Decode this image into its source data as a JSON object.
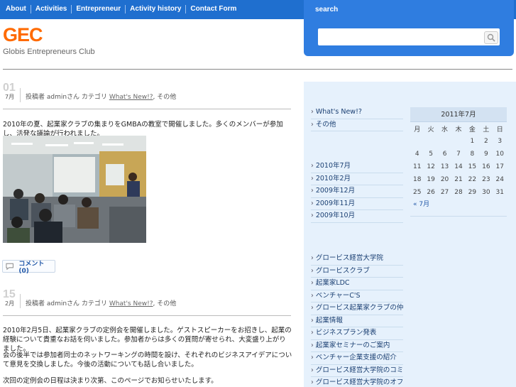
{
  "nav": {
    "items": [
      "About",
      "Activities",
      "Entrepreneur",
      "Activity history",
      "Contact Form"
    ]
  },
  "search": {
    "label": "search",
    "placeholder": ""
  },
  "site": {
    "logo": "GEC",
    "tagline": "Globis Entrepreneurs Club"
  },
  "posts": [
    {
      "day": "01",
      "month": "7月",
      "meta_prefix": "投稿者 adminさん カテゴリ",
      "category": "What's New!?",
      "meta_suffix": "その他",
      "text": "2010年の夏、起業家クラブの集まりをGMBAの教室で開催しました。多くのメンバーが参加し、活発な議論が行われました。",
      "comment_label": "コメント (0)"
    },
    {
      "day": "15",
      "month": "2月",
      "meta_prefix": "投稿者 adminさん カテゴリ",
      "category": "What's New!?",
      "meta_suffix": "その他",
      "paragraphs": [
        "2010年2月5日、起業家クラブの定例会を開催しました。ゲストスピーカーをお招きし、起業の経験について貴重なお話を伺いました。参加者からは多くの質問が寄せられ、大変盛り上がりました。",
        "会の後半では参加者同士のネットワーキングの時間を設け、それぞれのビジネスアイデアについて意見を交換しました。今後の活動についても話し合いました。",
        "次回の定例会の日程は決まり次第、このページでお知らせいたします。"
      ]
    }
  ],
  "sidebar": {
    "categories": [
      "What's New!?",
      "その他"
    ],
    "archives": [
      "2010年7月",
      "2010年2月",
      "2009年12月",
      "2009年11月",
      "2009年10月"
    ],
    "links": [
      "グロービス経営大学院",
      "グロービスクラブ",
      "起業家LDC",
      "ベンチャーC'S",
      "グロービス起業家クラブの仲間たち",
      "起業情報",
      "ビジネスプラン発表",
      "起業家セミナーのご案内",
      "ベンチャー企業支援の紹介",
      "グロービス経営大学院のコミュニティ",
      "グロービス経営大学院のオフィシャルサイト"
    ]
  },
  "calendar": {
    "caption": "2011年7月",
    "weekdays": [
      "月",
      "火",
      "水",
      "木",
      "金",
      "土",
      "日"
    ],
    "weeks": [
      [
        "",
        "",
        "",
        "",
        "1",
        "2",
        "3"
      ],
      [
        "4",
        "5",
        "6",
        "7",
        "8",
        "9",
        "10"
      ],
      [
        "11",
        "12",
        "13",
        "14",
        "15",
        "16",
        "17"
      ],
      [
        "18",
        "19",
        "20",
        "21",
        "22",
        "23",
        "24"
      ],
      [
        "25",
        "26",
        "27",
        "28",
        "29",
        "30",
        "31"
      ]
    ],
    "prev": "« 7月"
  }
}
